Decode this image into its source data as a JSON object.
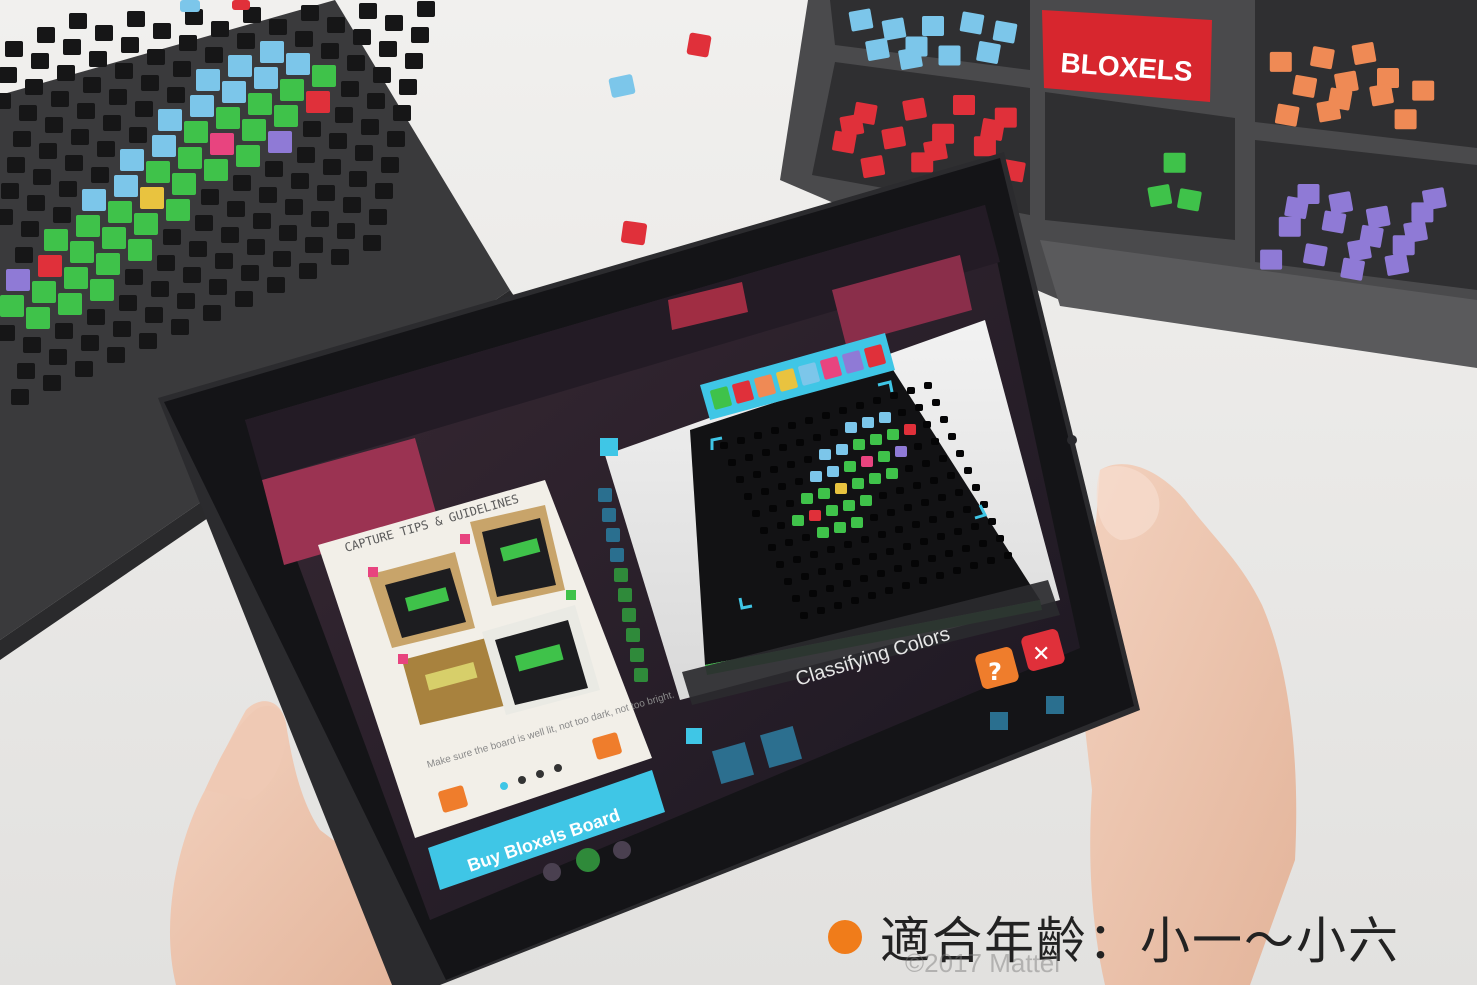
{
  "box": {
    "brand_label": "BLOXELS"
  },
  "tablet": {
    "guide_card": {
      "heading": "CAPTURE TIPS & GUIDELINES",
      "tip_text": "Make sure the board is well lit, not too dark, not too bright.",
      "buy_button_label": "Buy Bloxels Board"
    },
    "camera_view": {
      "status_label": "Classifying Colors"
    },
    "help_icon_glyph": "?",
    "close_icon_glyph": "✕"
  },
  "caption": {
    "text": "適合年齡：小一～小六",
    "bullet_color": "#f07c1a"
  },
  "watermark": {
    "text": "©2017 Mattel"
  },
  "colors": {
    "cube_green": "#3fc24a",
    "cube_blue": "#7cc6ea",
    "cube_red": "#e0303a",
    "cube_orange": "#ef8a55",
    "cube_purple": "#8f7ad6",
    "cube_yellow": "#e9c33f",
    "cube_pink": "#e8447f",
    "accent_pink": "#c23d62",
    "accent_cyan": "#3fc6e6"
  }
}
